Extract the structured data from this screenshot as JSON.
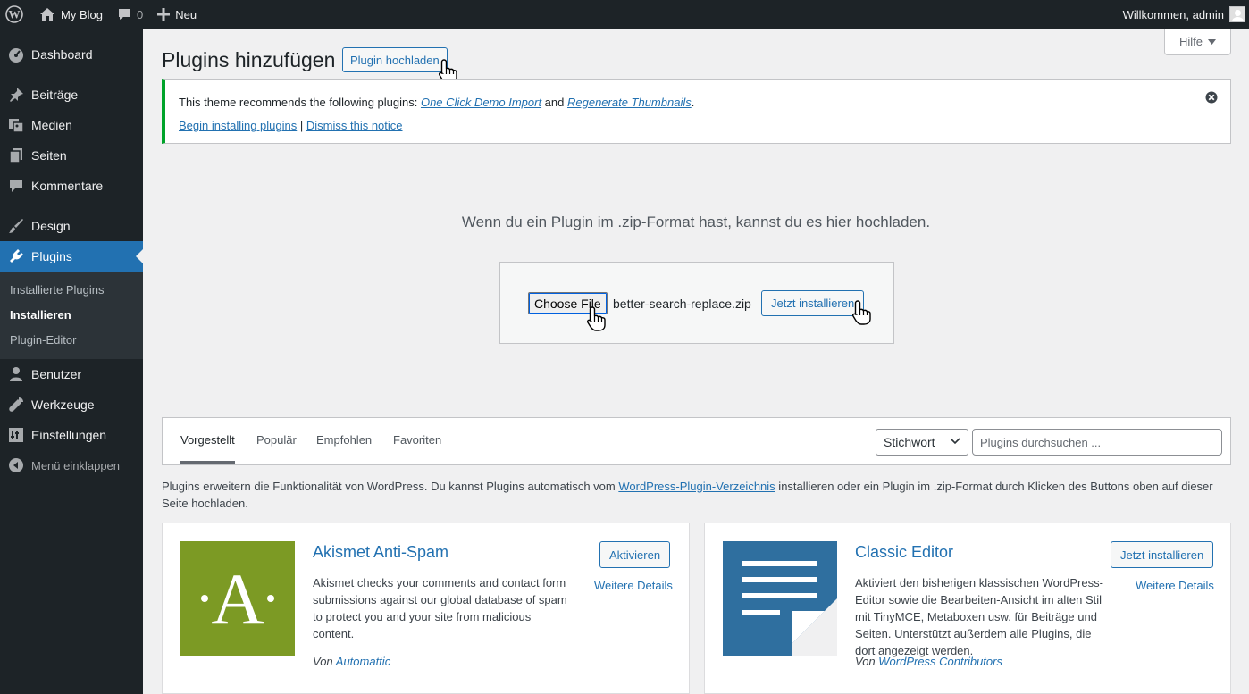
{
  "adminbar": {
    "site_name": "My Blog",
    "comments_count": "0",
    "new_label": "Neu",
    "greeting": "Willkommen, admin"
  },
  "sidebar": {
    "items": [
      {
        "label": "Dashboard",
        "icon": "dashboard-icon"
      },
      {
        "label": "Beiträge",
        "icon": "pin-icon"
      },
      {
        "label": "Medien",
        "icon": "media-icon"
      },
      {
        "label": "Seiten",
        "icon": "pages-icon"
      },
      {
        "label": "Kommentare",
        "icon": "comment-icon"
      },
      {
        "label": "Design",
        "icon": "brush-icon"
      },
      {
        "label": "Plugins",
        "icon": "plugin-icon"
      },
      {
        "label": "Benutzer",
        "icon": "user-icon"
      },
      {
        "label": "Werkzeuge",
        "icon": "wrench-icon"
      },
      {
        "label": "Einstellungen",
        "icon": "settings-icon"
      },
      {
        "label": "Menü einklappen",
        "icon": "collapse-icon"
      }
    ],
    "submenu": [
      "Installierte Plugins",
      "Installieren",
      "Plugin-Editor"
    ]
  },
  "header": {
    "help_label": "Hilfe",
    "title": "Plugins hinzufügen",
    "upload_button": "Plugin hochladen"
  },
  "notice": {
    "text_before": "This theme recommends the following plugins: ",
    "plugin1": "One Click Demo Import",
    "and_text": " and ",
    "plugin2": "Regenerate Thumbnails",
    "period": ".",
    "begin_link": "Begin installing plugins",
    "separator": " | ",
    "dismiss_link": "Dismiss this notice"
  },
  "upload": {
    "instruction": "Wenn du ein Plugin im .zip-Format hast, kannst du es hier hochladen.",
    "choose_file": "Choose File",
    "file_name": "better-search-replace.zip",
    "install_button": "Jetzt installieren"
  },
  "filter": {
    "tabs": [
      "Vorgestellt",
      "Populär",
      "Empfohlen",
      "Favoriten"
    ],
    "select_value": "Stichwort",
    "search_placeholder": "Plugins durchsuchen ..."
  },
  "description": {
    "before": "Plugins erweitern die Funktionalität von WordPress. Du kannst Plugins automatisch vom ",
    "link": "WordPress-Plugin-Verzeichnis",
    "after": " installieren oder ein Plugin im .zip-Format durch Klicken des Buttons oben auf dieser Seite hochladen."
  },
  "plugins": [
    {
      "name": "Akismet Anti-Spam",
      "summary": "Akismet checks your comments and contact form submissions against our global database of spam to protect you and your site from malicious content.",
      "by": "Von ",
      "author": "Automattic",
      "action": "Aktivieren",
      "more": "Weitere Details",
      "thumb_letter": "A",
      "thumb_color": "#7c9a24"
    },
    {
      "name": "Classic Editor",
      "summary": "Aktiviert den bisherigen klassischen WordPress-Editor sowie die Bearbeiten-Ansicht im alten Stil mit TinyMCE, Metaboxen usw. für Beiträge und Seiten. Unterstützt außerdem alle Plugins, die dort angezeigt werden.",
      "by": "Von ",
      "author": "WordPress Contributors",
      "action": "Jetzt installieren",
      "more": "Weitere Details",
      "thumb_color": "#2f6f9f"
    }
  ],
  "colors": {
    "sidebar_bg": "#1d2327",
    "accent": "#2271b1",
    "notice_border": "#00a32a"
  }
}
